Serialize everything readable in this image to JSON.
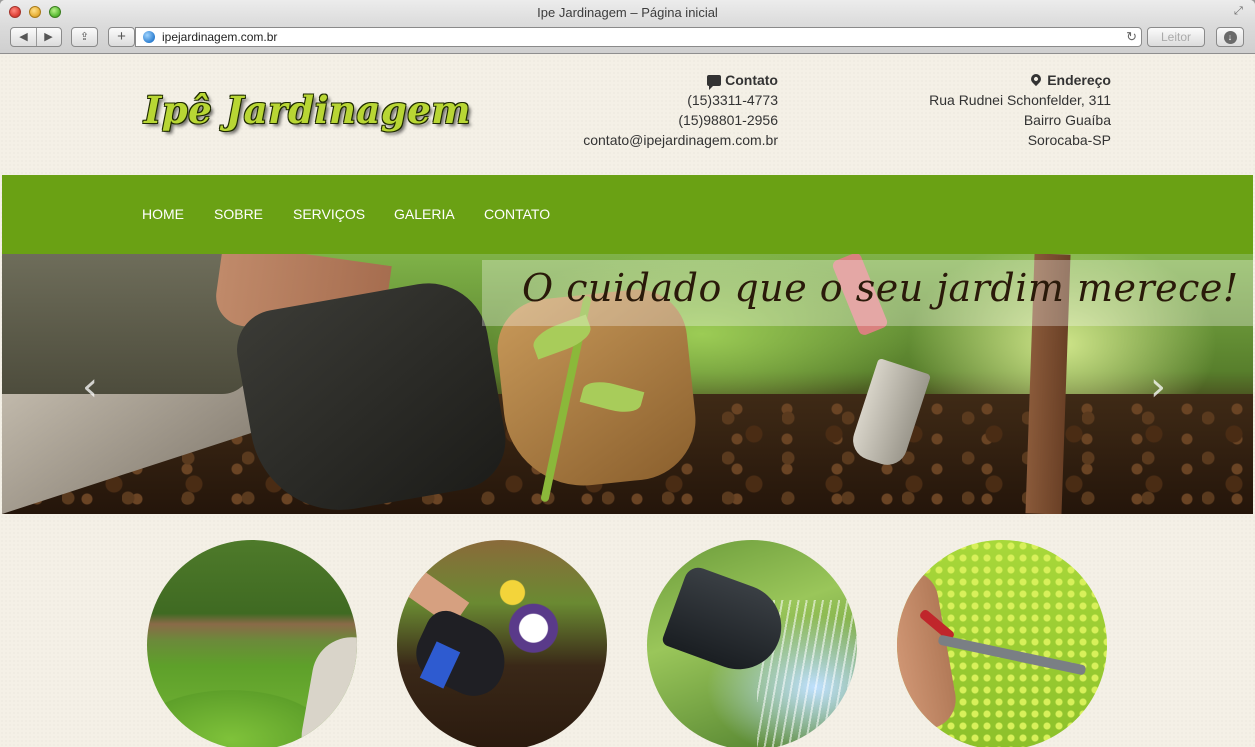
{
  "browser": {
    "window_title": "Ipe Jardinagem – Página inicial",
    "url": "ipejardinagem.com.br",
    "reader_label": "Leitor",
    "back_glyph": "◀",
    "forward_glyph": "▶",
    "add_glyph": "+",
    "reload_glyph": "↻"
  },
  "site": {
    "logo": "Ipê Jardinagem",
    "contact": {
      "heading": "Contato",
      "phone1": "(15)3311-4773",
      "phone2": "(15)98801-2956",
      "email": "contato@ipejardinagem.com.br"
    },
    "address": {
      "heading": "Endereço",
      "street": "Rua Rudnei Schonfelder, 311",
      "district": "Bairro Guaíba",
      "city": "Sorocaba-SP"
    },
    "nav": [
      "HOME",
      "SOBRE",
      "SERVIÇOS",
      "GALERIA",
      "CONTATO"
    ],
    "hero": {
      "caption": "O cuidado que o seu jardim merece!",
      "prev_glyph": "‹",
      "next_glyph": "›"
    },
    "colors": {
      "nav_green": "#6aa114",
      "logo_green": "#b8d634",
      "page_bg": "#f4f0e6"
    }
  }
}
